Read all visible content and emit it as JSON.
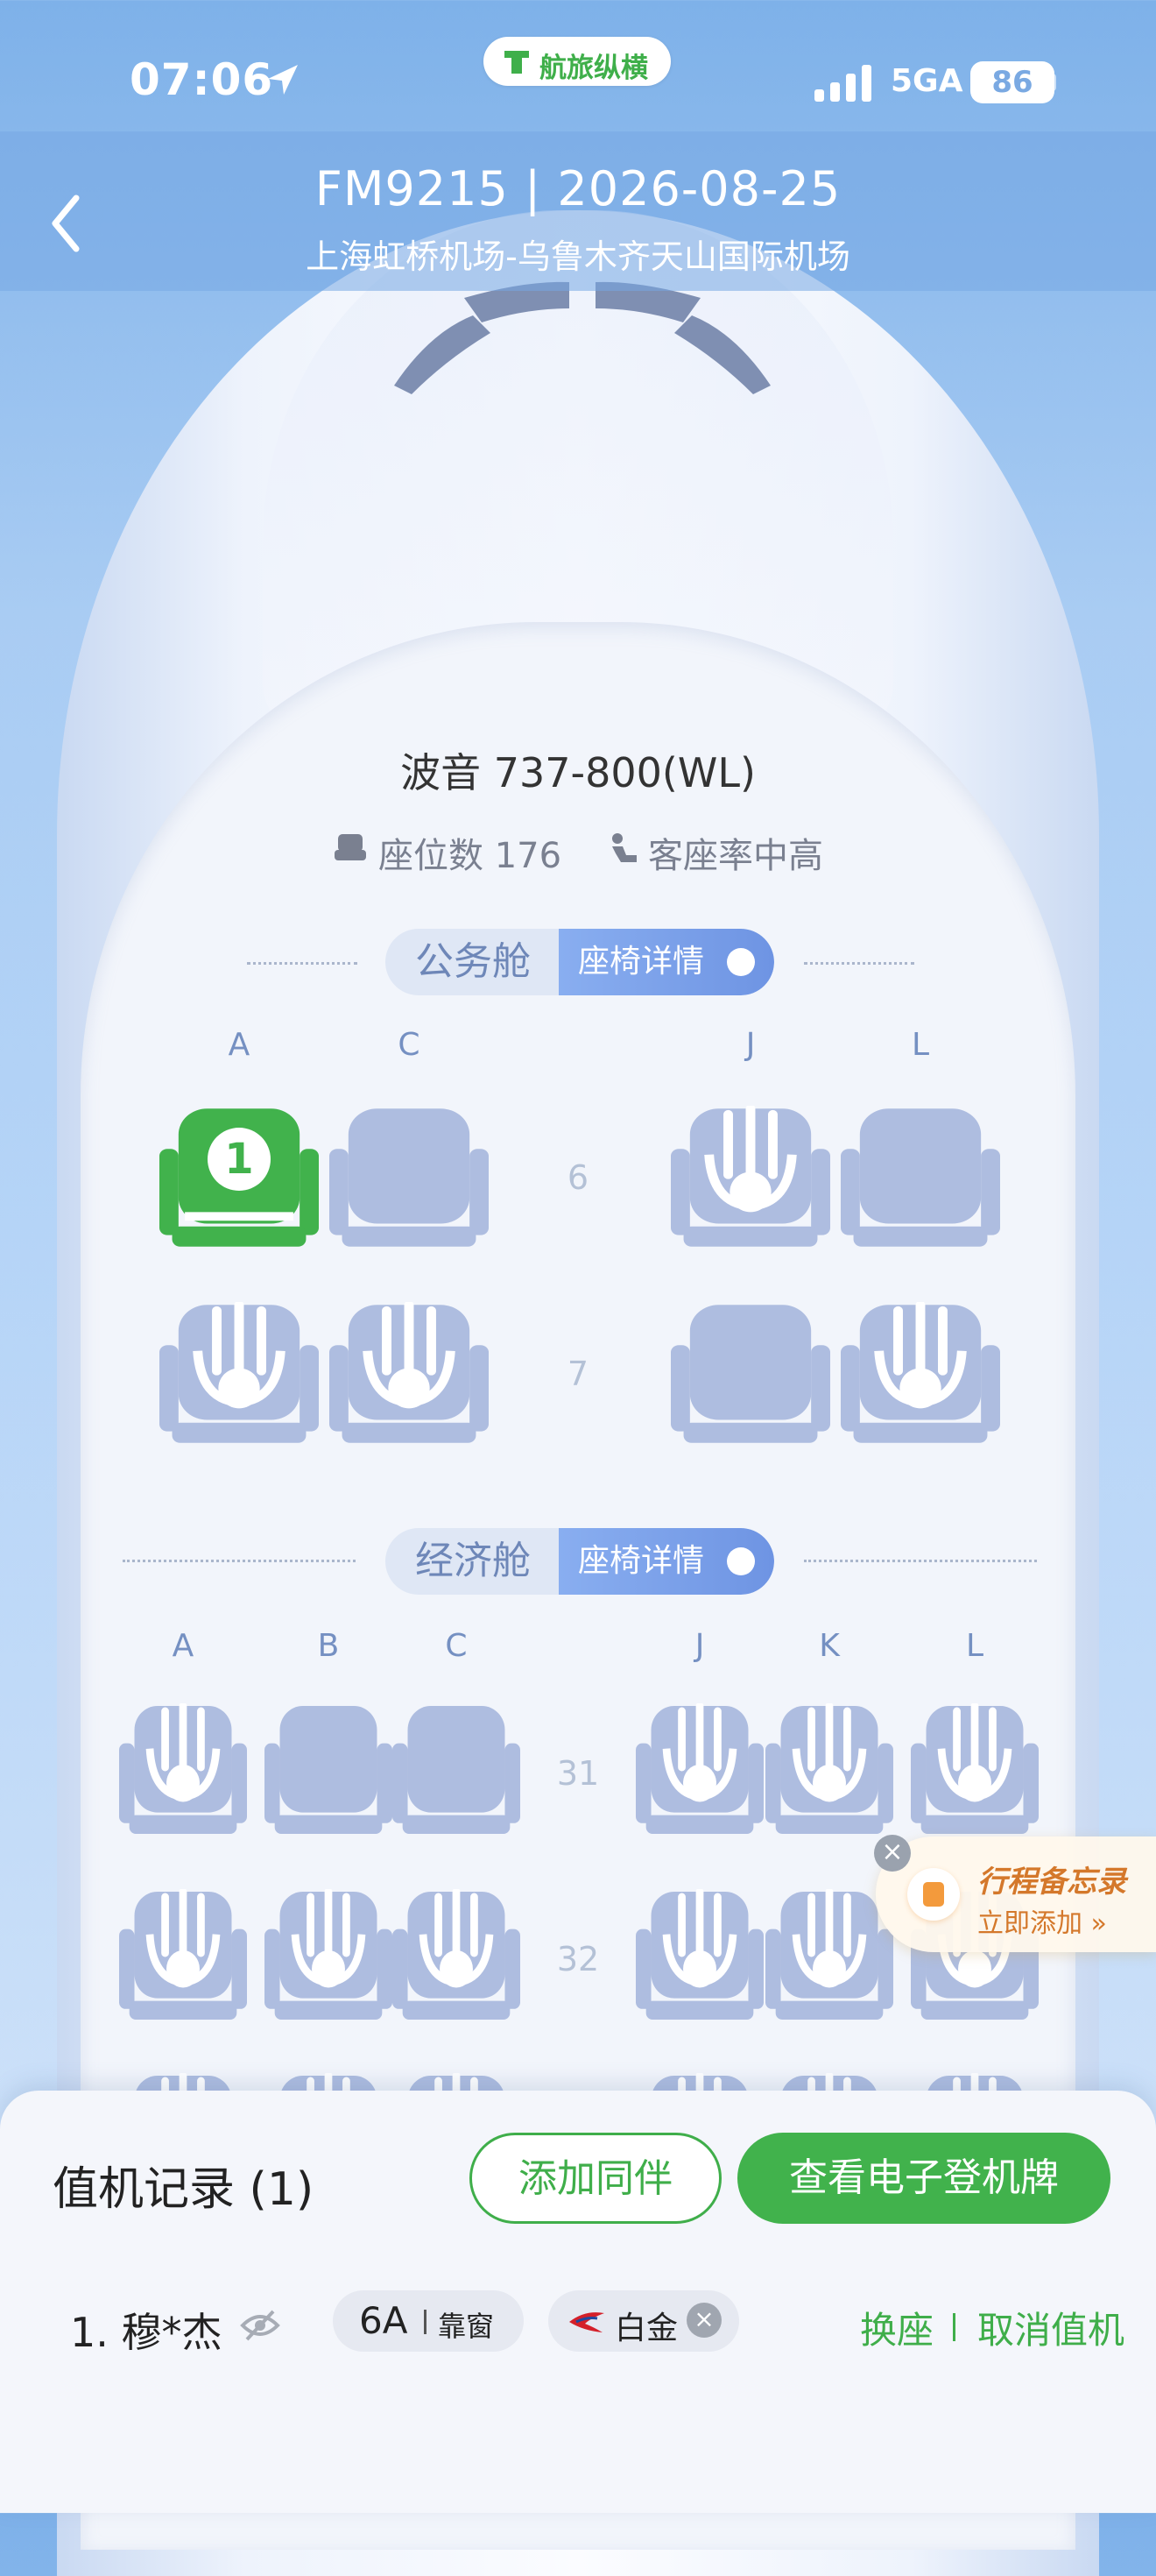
{
  "status_bar": {
    "time": "07:06",
    "app_name": "航旅纵横",
    "network": "5GA",
    "battery": "86"
  },
  "header": {
    "title": "FM9215 | 2026-08-25",
    "route": "上海虹桥机场-乌鲁木齐天山国际机场",
    "back_icon": "chevron-left-icon"
  },
  "aircraft": {
    "model": "波音 737-800(WL)",
    "seat_count": "座位数 176",
    "load_factor": "客座率中高"
  },
  "business": {
    "cabin_name": "公务舱",
    "detail_label": "座椅详情",
    "columns": [
      "A",
      "C",
      "J",
      "L"
    ],
    "rows": [
      {
        "num": "6",
        "seats": [
          "selected",
          "empty",
          "occupied",
          "empty"
        ]
      },
      {
        "num": "7",
        "seats": [
          "occupied",
          "occupied",
          "empty",
          "occupied"
        ]
      }
    ],
    "selected_marker": "1"
  },
  "economy": {
    "cabin_name": "经济舱",
    "detail_label": "座椅详情",
    "columns": [
      "A",
      "B",
      "C",
      "J",
      "K",
      "L"
    ],
    "rows": [
      {
        "num": "31",
        "seats": [
          "occupied",
          "empty",
          "empty",
          "occupied",
          "occupied",
          "occupied"
        ]
      },
      {
        "num": "32",
        "seats": [
          "occupied",
          "occupied",
          "occupied",
          "occupied",
          "occupied",
          "occupied"
        ]
      }
    ]
  },
  "memo_widget": {
    "title": "行程备忘录",
    "action": "立即添加 »"
  },
  "checkin": {
    "title": "值机记录 (1)",
    "add_companion": "添加同伴",
    "view_boarding_pass": "查看电子登机牌",
    "passenger": "1. 穆*杰",
    "seat": "6A",
    "seat_type": "靠窗",
    "tier": "白金",
    "change_seat": "换座",
    "cancel_checkin": "取消值机"
  },
  "colors": {
    "accent_green": "#41b24c",
    "seat_blue": "#aebde0",
    "header_blue": "#77a8e4"
  }
}
